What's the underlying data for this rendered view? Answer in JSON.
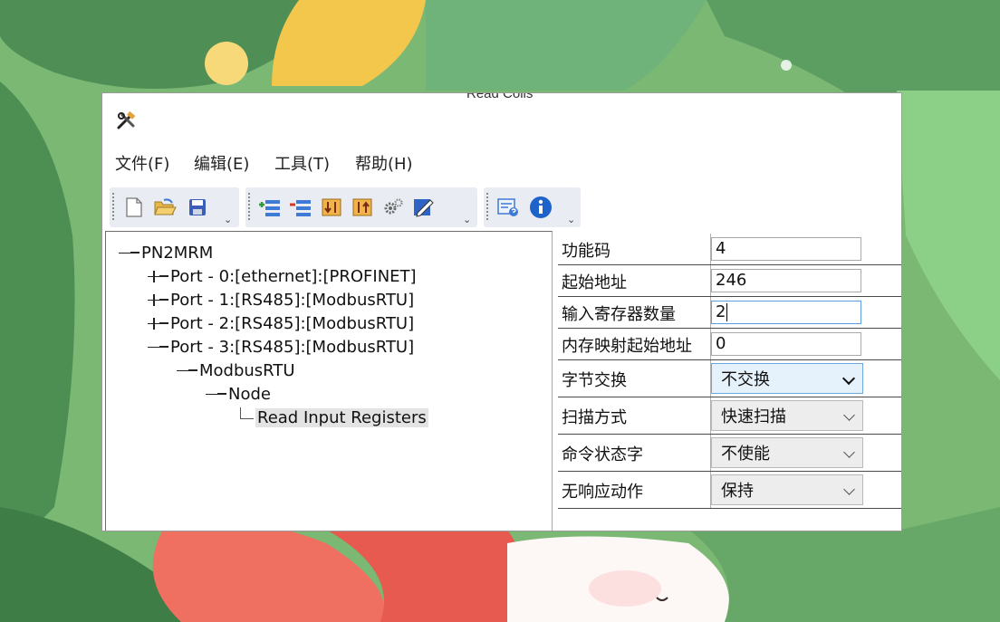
{
  "window": {
    "title_peek": "Read Coils"
  },
  "menu": [
    {
      "label": "文件(F)"
    },
    {
      "label": "编辑(E)"
    },
    {
      "label": "工具(T)"
    },
    {
      "label": "帮助(H)"
    }
  ],
  "toolbar": {
    "groups": [
      {
        "icons": [
          "new-file-icon",
          "open-folder-icon",
          "save-icon"
        ]
      },
      {
        "icons": [
          "add-port-icon",
          "remove-port-icon",
          "move-down-icon",
          "move-up-icon",
          "settings-gear-icon",
          "edit-note-icon"
        ]
      },
      {
        "icons": [
          "monitor-icon",
          "info-icon"
        ]
      }
    ],
    "more_glyph": "⌄"
  },
  "tree": {
    "root": "PN2MRM",
    "ports": [
      "Port - 0:[ethernet]:[PROFINET]",
      "Port - 1:[RS485]:[ModbusRTU]",
      "Port - 2:[RS485]:[ModbusRTU]",
      "Port - 3:[RS485]:[ModbusRTU]"
    ],
    "protocol": "ModbusRTU",
    "node": "Node",
    "selected_item": "Read Input Registers"
  },
  "properties": {
    "rows": [
      {
        "label": "功能码",
        "value": "4"
      },
      {
        "label": "起始地址",
        "value": "246"
      },
      {
        "label": "输入寄存器数量",
        "value": "2"
      },
      {
        "label": "内存映射起始地址",
        "value": "0"
      },
      {
        "label": "字节交换",
        "value": "不交换"
      },
      {
        "label": "扫描方式",
        "value": "快速扫描"
      },
      {
        "label": "命令状态字",
        "value": "不使能"
      },
      {
        "label": "无响应动作",
        "value": "保持"
      }
    ]
  },
  "colors": {
    "accent_focus": "#5aa0e0",
    "info_blue": "#1d63c9",
    "window_bg": "#ffffff"
  }
}
